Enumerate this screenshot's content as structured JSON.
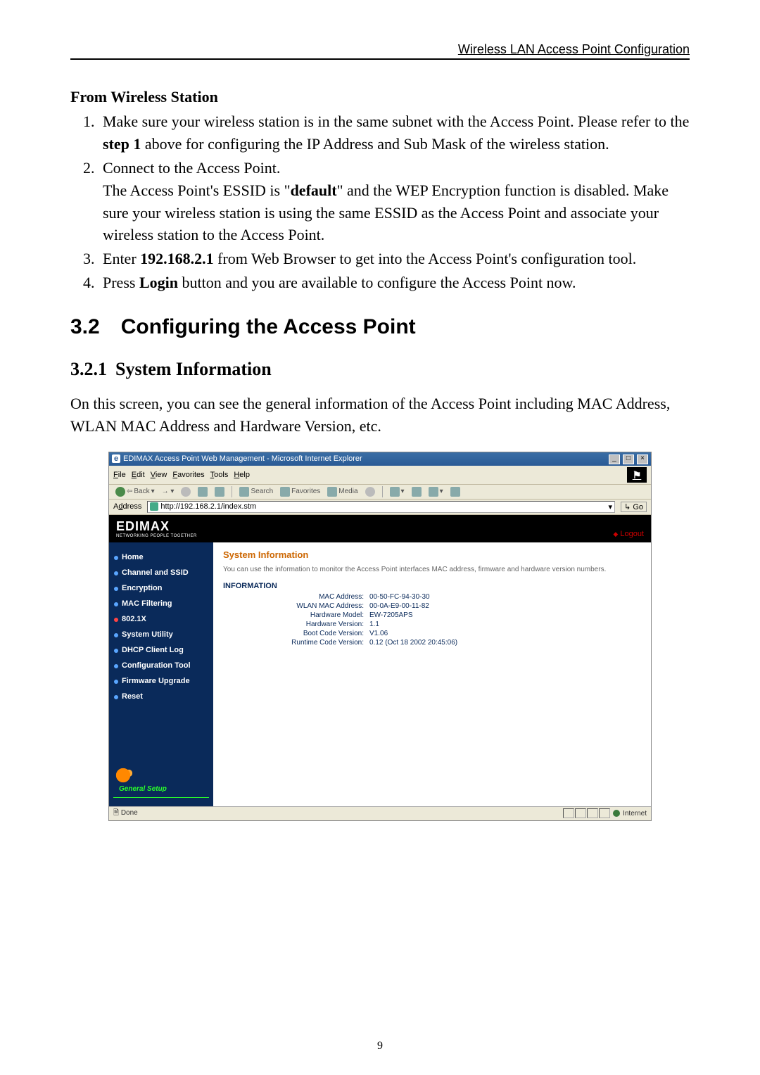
{
  "header": "Wireless LAN Access Point Configuration",
  "wireless_station": {
    "title": "From Wireless Station",
    "steps": [
      "Make sure your wireless station is in the same subnet with the Access Point. Please refer to the step 1 above for configuring the IP Address and Sub Mask of the wireless station.",
      "Connect to the Access Point.\nThe Access Point's ESSID is \"default\" and the WEP Encryption function is disabled. Make sure your wireless station is using the same ESSID as the Access Point and associate your wireless station to the Access Point.",
      "Enter 192.168.2.1 from Web Browser to get into the Access Point's configuration tool.",
      "Press Login button and you are available to configure the Access Point now."
    ],
    "bold": {
      "step1": "step 1",
      "default": "default",
      "ip": "192.168.2.1",
      "login": "Login"
    }
  },
  "section": {
    "num": "3.2",
    "title": "Configuring the Access Point"
  },
  "subsection": {
    "num": "3.2.1",
    "title": "System Information"
  },
  "intro": "On this screen, you can see the general information of the Access Point including MAC Address, WLAN MAC Address and Hardware Version, etc.",
  "ie": {
    "title": "EDIMAX Access Point Web Management - Microsoft Internet Explorer",
    "menu": [
      "File",
      "Edit",
      "View",
      "Favorites",
      "Tools",
      "Help"
    ],
    "toolbar": {
      "back": "Back",
      "search": "Search",
      "favorites": "Favorites",
      "media": "Media"
    },
    "address_label": "Address",
    "address_value": "http://192.168.2.1/index.stm",
    "go": "Go",
    "status_left": "Done",
    "status_right": "Internet"
  },
  "ap": {
    "brand": "EDIMAX",
    "brand_tag": "NETWORKING PEOPLE TOGETHER",
    "logout": "Logout",
    "sidebar": [
      {
        "label": "Home",
        "red": false
      },
      {
        "label": "Channel and SSID",
        "red": false
      },
      {
        "label": "Encryption",
        "red": false
      },
      {
        "label": "MAC Filtering",
        "red": false
      },
      {
        "label": "802.1X",
        "red": true
      },
      {
        "label": "System Utility",
        "red": false
      },
      {
        "label": "DHCP Client Log",
        "red": false
      },
      {
        "label": "Configuration Tool",
        "red": false
      },
      {
        "label": "Firmware Upgrade",
        "red": false
      },
      {
        "label": "Reset",
        "red": false
      }
    ],
    "general_setup": "General Setup",
    "main": {
      "title": "System Information",
      "desc": "You can use the information to monitor the Access Point interfaces MAC address, firmware and hardware version numbers.",
      "info_label": "INFORMATION",
      "rows": [
        {
          "k": "MAC Address:",
          "v": "00-50-FC-94-30-30"
        },
        {
          "k": "WLAN MAC Address:",
          "v": "00-0A-E9-00-11-82"
        },
        {
          "k": "Hardware Model:",
          "v": "EW-7205APS"
        },
        {
          "k": "Hardware Version:",
          "v": "1.1"
        },
        {
          "k": "Boot Code Version:",
          "v": "V1.06"
        },
        {
          "k": "Runtime Code Version:",
          "v": "0.12 (Oct 18 2002 20:45:06)"
        }
      ]
    }
  },
  "page_number": "9"
}
